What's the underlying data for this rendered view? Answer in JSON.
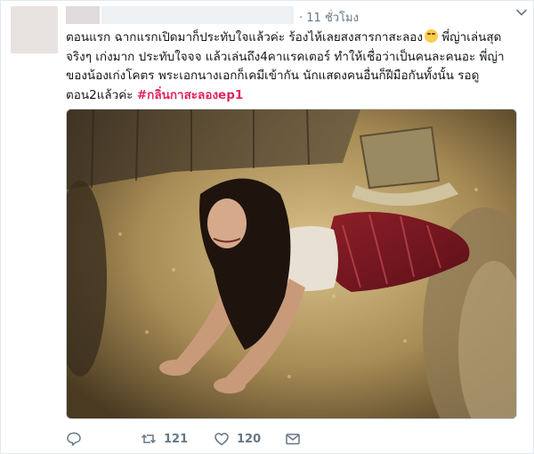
{
  "tweet": {
    "timestamp": "· 11 ชั่วโมง",
    "lines": [
      "ตอนแรก ฉากแรกเปิดมาก็ประทับใจแล้วค่ะ ร้องไห้เลยสงสารกาสะลอง",
      "จริงๆ เก่งมาก ประทับใจจจ แล้วเล่นถึง4คาแรคเตอร์ ทำให้เชื่อว่าเป็นคนละคนอะ พี่ญ่า",
      "ของน้องเก่งโคตร พระเอกนางเอกก็เคมีเข้ากัน นักแสดงคนอื่นก็ฝีมือกันทั้งนั้น รอดู",
      "ตอน2แล้วค่ะ"
    ],
    "line1_suffix": " พี่ญ่าเล่นสุด",
    "hashtag": "#กลิ่นกาสะลองep1",
    "emoji": "crying-face-emoji",
    "media_icon": "drama-scene-photo"
  },
  "actions": {
    "reply_icon": "reply-icon",
    "retweet_icon": "retweet-icon",
    "retweet_count": "121",
    "like_icon": "heart-icon",
    "like_count": "120",
    "dm_icon": "envelope-icon"
  },
  "colors": {
    "hashtag": "#e0245e",
    "muted": "#657786",
    "border": "#e1e8ed"
  }
}
